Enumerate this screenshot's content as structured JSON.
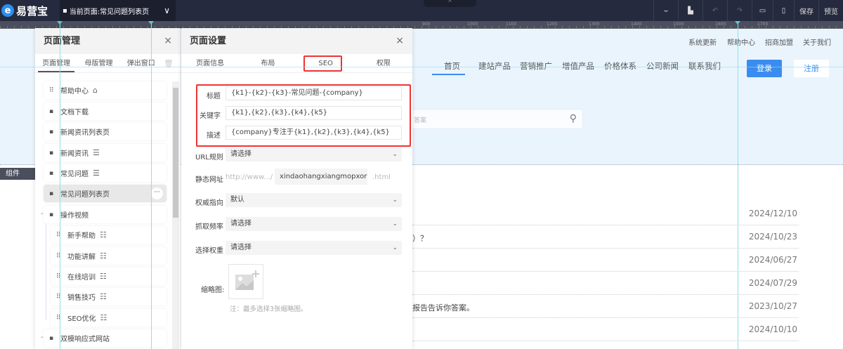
{
  "topbar": {
    "logo": "易营宝",
    "current_page": "当前页面:常见问题列表页",
    "save": "保存",
    "preview": "预览"
  },
  "ruler": [
    "900",
    "1000",
    "1100",
    "1200",
    "1300",
    "1400",
    "1500",
    "1600",
    "1700"
  ],
  "site": {
    "top_links": [
      "系统更新",
      "帮助中心",
      "招商加盟",
      "关于我们"
    ],
    "nav": [
      "首页",
      "建站产品",
      "营销推广",
      "增值产品",
      "价格体系",
      "公司新闻",
      "联系我们"
    ],
    "login": "登录",
    "register": "注册",
    "search_placeholder": "答案",
    "rows": [
      {
        "text": "",
        "date": "2024/12/10"
      },
      {
        "text": "）？",
        "date": "2024/10/23"
      },
      {
        "text": "",
        "date": "2024/06/27"
      },
      {
        "text": "",
        "date": "2024/07/29"
      },
      {
        "text": "报告告诉你答案。",
        "date": "2023/10/27"
      },
      {
        "text": "",
        "date": "2024/10/10"
      }
    ]
  },
  "left_strip": {
    "components": "组件"
  },
  "page_manager": {
    "title": "页面管理",
    "tabs": [
      "页面管理",
      "母版管理",
      "弹出窗口"
    ],
    "items": [
      {
        "label": "帮助中心",
        "icon": "grid-icon"
      },
      {
        "label": "文档下载",
        "icon": "file-icon"
      },
      {
        "label": "新闻资讯列表页",
        "icon": "file-icon"
      },
      {
        "label": "新闻资讯",
        "icon": "file-icon"
      },
      {
        "label": "常见问题",
        "icon": "file-icon"
      },
      {
        "label": "常见问题列表页",
        "icon": "file-icon"
      },
      {
        "label": "操作视频",
        "icon": "file-icon"
      },
      {
        "label": "新手帮助",
        "icon": "grid-icon"
      },
      {
        "label": "功能讲解",
        "icon": "grid-icon"
      },
      {
        "label": "在线培训",
        "icon": "grid-icon"
      },
      {
        "label": "销售技巧",
        "icon": "grid-icon"
      },
      {
        "label": "SEO优化",
        "icon": "grid-icon"
      },
      {
        "label": "双模响应式网站",
        "icon": "file-icon"
      }
    ]
  },
  "page_settings": {
    "title": "页面设置",
    "tabs": [
      "页面信息",
      "布局",
      "SEO",
      "权限"
    ],
    "active_tab": "SEO",
    "fields": {
      "title_label": "标题",
      "title_value": "{k1}-{k2}-{k3}-常见问题-{company}",
      "keywords_label": "关键字",
      "keywords_value": "{k1},{k2},{k3},{k4},{k5}",
      "desc_label": "描述",
      "desc_value": "{company}专注于{k1},{k2},{k3},{k4},{k5}",
      "url_rule_label": "URL规则",
      "url_rule_value": "请选择",
      "static_url_label": "静态网址",
      "static_url_prefix": "http://www.../",
      "static_url_value": "xindaohangxiangmopxor",
      "static_url_suffix": ".html",
      "canonical_label": "权威指向",
      "canonical_value": "默认",
      "crawl_label": "抓取频率",
      "crawl_value": "请选择",
      "weight_label": "选择权重",
      "weight_value": "请选择",
      "thumb_label": "缩略图:",
      "thumb_note": "注：最多选择3张缩略图。"
    }
  },
  "colors": {
    "accent": "#3b8cf0",
    "highlight": "#ee3333",
    "topbar": "#262a3e"
  }
}
